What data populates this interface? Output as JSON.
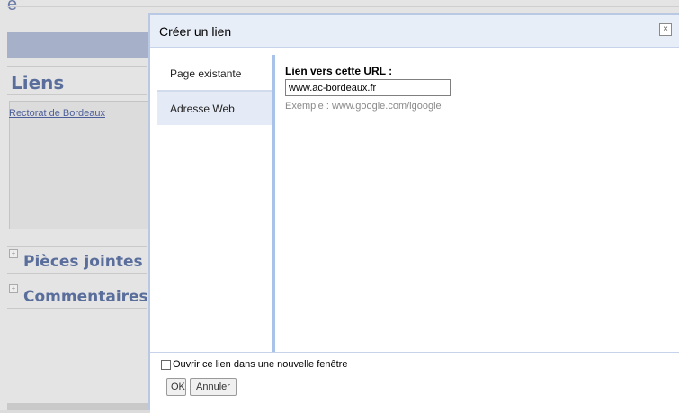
{
  "background": {
    "logo_glyph": "e",
    "links_title": "Liens",
    "links_item": "Rectorat de Bordeaux",
    "attachments_title": "Pièces jointes",
    "comments_title": "Commentaires",
    "expander_glyph": "+"
  },
  "dialog": {
    "title": "Créer un lien",
    "close_glyph": "×",
    "tabs": [
      {
        "label": "Page existante",
        "selected": false
      },
      {
        "label": "Adresse Web",
        "selected": true
      }
    ],
    "url_label": "Lien vers cette URL :",
    "url_value": "www.ac-bordeaux.fr",
    "example_text": "Exemple : www.google.com/igoogle",
    "new_window_label": "Ouvrir ce lien dans une nouvelle fenêtre",
    "new_window_checked": false,
    "ok_label": "OK",
    "cancel_label": "Annuler"
  },
  "colors": {
    "accent_blue": "#a9c2e9",
    "header_bg": "#e8eef8",
    "section_title": "#5a6e9c"
  }
}
